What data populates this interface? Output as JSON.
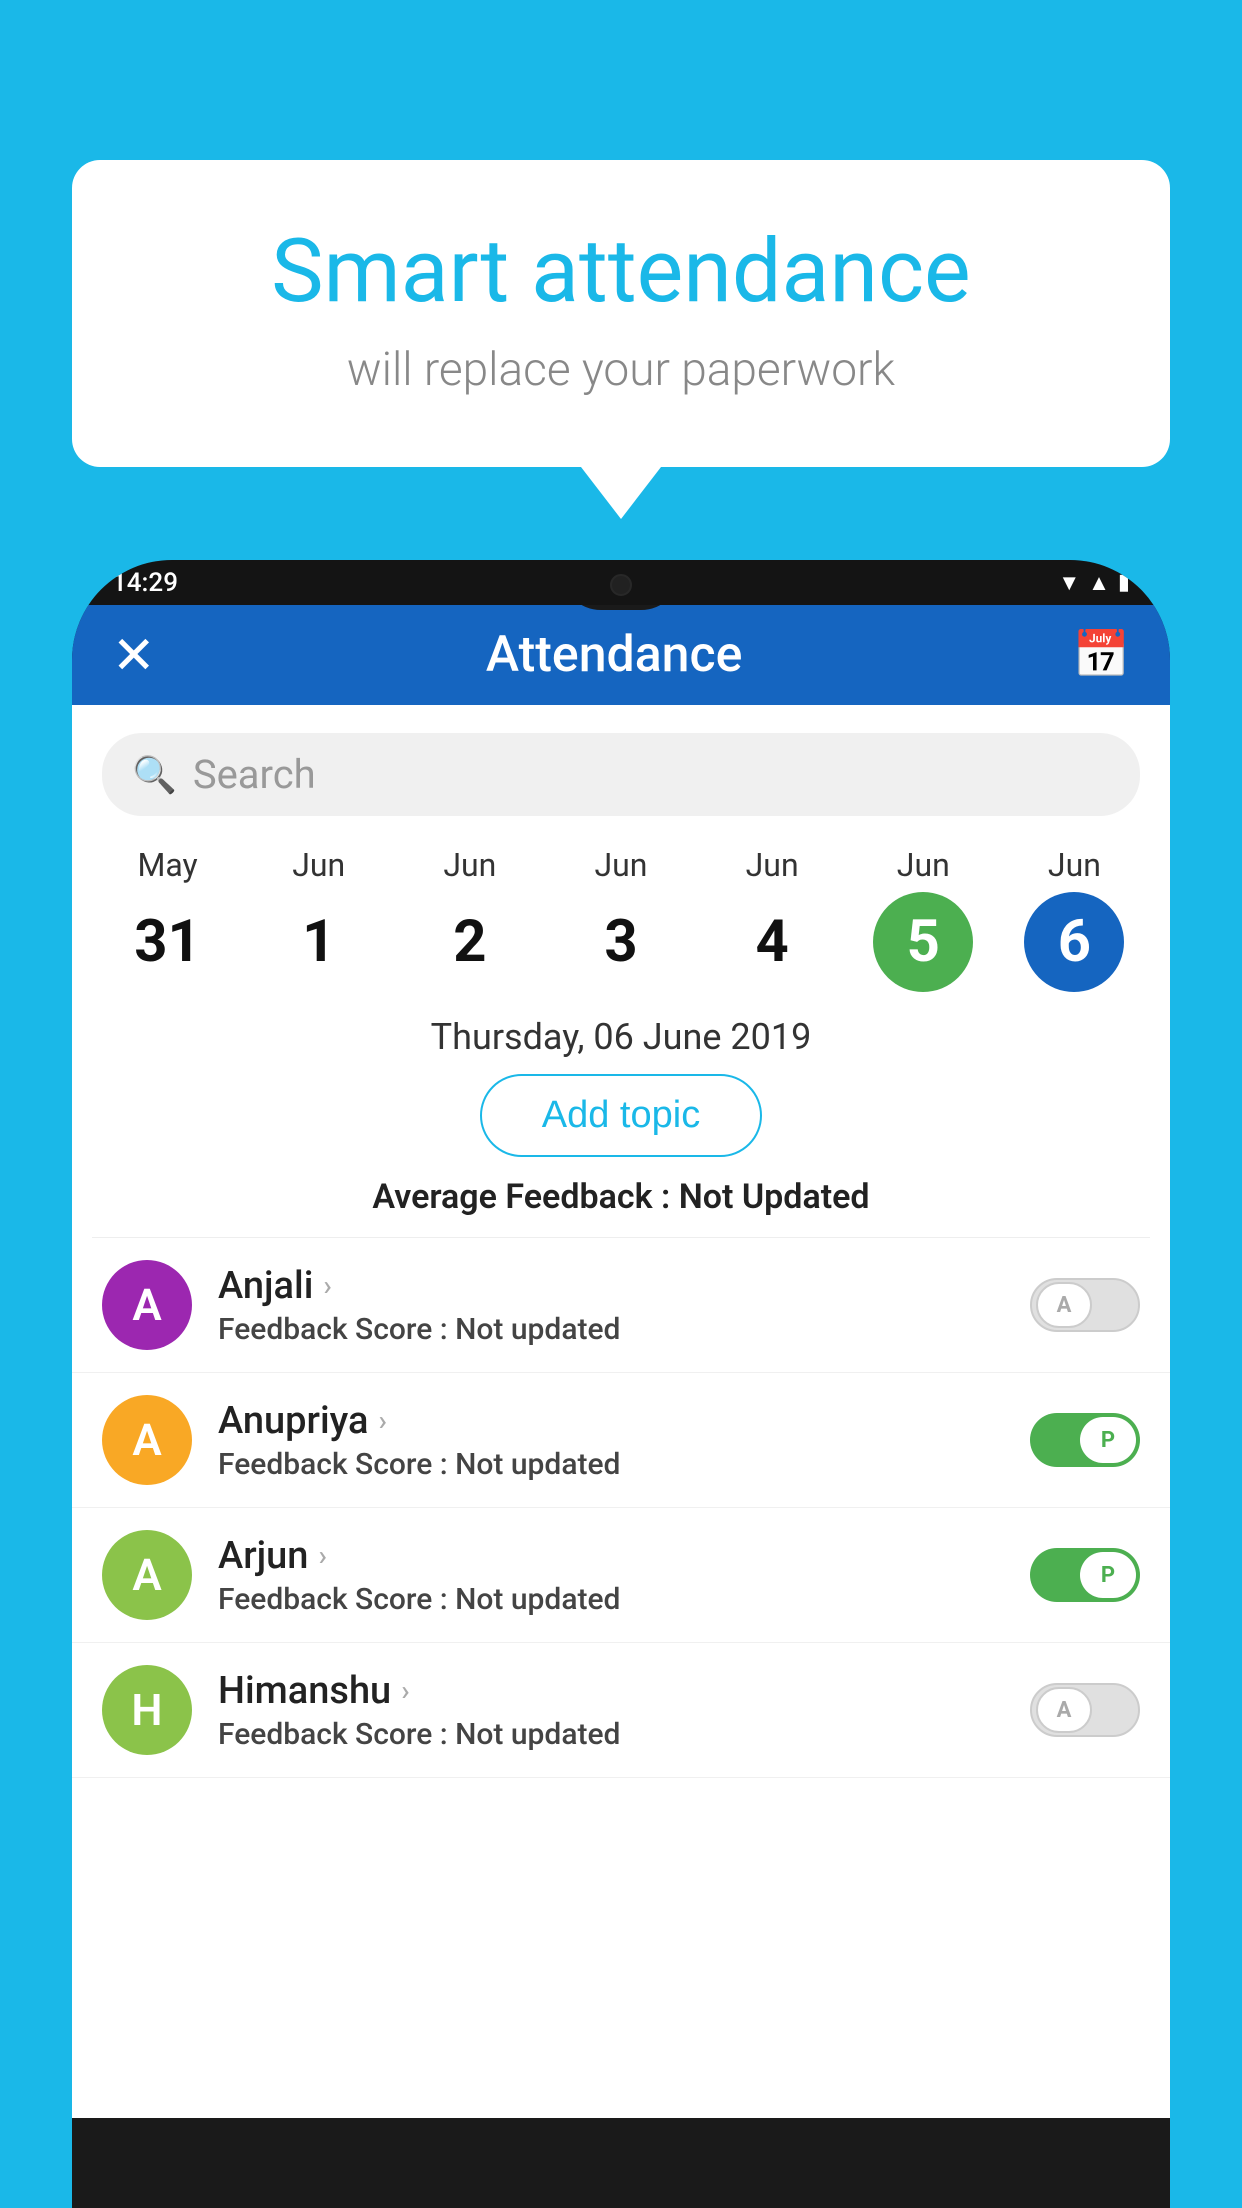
{
  "background": {
    "color": "#1ab8e8"
  },
  "bubble": {
    "title": "Smart attendance",
    "subtitle": "will replace your paperwork"
  },
  "phone": {
    "status_bar": {
      "time": "14:29",
      "icons": [
        "wifi",
        "signal",
        "battery"
      ]
    },
    "header": {
      "close_label": "×",
      "title": "Attendance",
      "calendar_icon": "📅"
    },
    "search": {
      "placeholder": "Search"
    },
    "calendar": {
      "days": [
        {
          "month": "May",
          "day": "31",
          "state": "normal"
        },
        {
          "month": "Jun",
          "day": "1",
          "state": "normal"
        },
        {
          "month": "Jun",
          "day": "2",
          "state": "normal"
        },
        {
          "month": "Jun",
          "day": "3",
          "state": "normal"
        },
        {
          "month": "Jun",
          "day": "4",
          "state": "normal"
        },
        {
          "month": "Jun",
          "day": "5",
          "state": "today"
        },
        {
          "month": "Jun",
          "day": "6",
          "state": "selected"
        }
      ]
    },
    "selected_date": "Thursday, 06 June 2019",
    "add_topic_label": "Add topic",
    "avg_feedback_label": "Average Feedback :",
    "avg_feedback_value": "Not Updated",
    "students": [
      {
        "name": "Anjali",
        "initial": "A",
        "avatar_color": "#9c27b0",
        "feedback_label": "Feedback Score :",
        "feedback_value": "Not updated",
        "toggle_state": "off",
        "toggle_letter": "A"
      },
      {
        "name": "Anupriya",
        "initial": "A",
        "avatar_color": "#f9a825",
        "feedback_label": "Feedback Score :",
        "feedback_value": "Not updated",
        "toggle_state": "on",
        "toggle_letter": "P"
      },
      {
        "name": "Arjun",
        "initial": "A",
        "avatar_color": "#8bc34a",
        "feedback_label": "Feedback Score :",
        "feedback_value": "Not updated",
        "toggle_state": "on",
        "toggle_letter": "P"
      },
      {
        "name": "Himanshu",
        "initial": "H",
        "avatar_color": "#8bc34a",
        "feedback_label": "Feedback Score :",
        "feedback_value": "Not updated",
        "toggle_state": "off",
        "toggle_letter": "A"
      }
    ]
  }
}
